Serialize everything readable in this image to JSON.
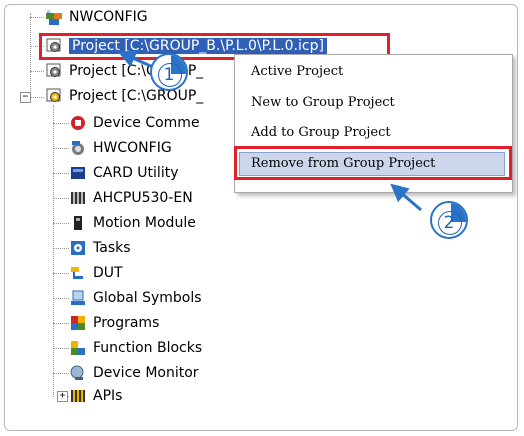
{
  "tree": {
    "nwconfig": "NWCONFIG",
    "projects": [
      "Project [C:\\GROUP_B.\\P.L.0\\P.L.0.icp]",
      "Project [C:\\GROUP_",
      "Project [C:\\GROUP_"
    ],
    "partial_visible": [
      "Project [C",
      "UP_",
      "Project [C",
      "UP_"
    ],
    "children": [
      {
        "label": "Device Comme",
        "icon": "device-comment-icon"
      },
      {
        "label": "HWCONFIG",
        "icon": "hwconfig-icon"
      },
      {
        "label": "CARD Utility",
        "icon": "card-utility-icon"
      },
      {
        "label": "AHCPU530-EN",
        "icon": "cpu-icon"
      },
      {
        "label": "Motion Module",
        "icon": "motion-module-icon"
      },
      {
        "label": "Tasks",
        "icon": "tasks-icon"
      },
      {
        "label": "DUT",
        "icon": "dut-icon"
      },
      {
        "label": "Global Symbols",
        "icon": "global-symbols-icon"
      },
      {
        "label": "Programs",
        "icon": "programs-icon"
      },
      {
        "label": "Function Blocks",
        "icon": "function-blocks-icon"
      },
      {
        "label": "Device Monitor",
        "icon": "device-monitor-icon"
      },
      {
        "label": "APIs",
        "icon": "apis-icon"
      }
    ]
  },
  "context_menu": {
    "items": [
      "Active Project",
      "New to Group Project",
      "Add to Group Project",
      "Remove from Group Project"
    ],
    "highlighted_index": 3
  },
  "annotations": {
    "step1": "1",
    "step2": "2"
  },
  "colors": {
    "selection": "#2f5fb6",
    "highlight_box": "#e0202a",
    "callout_blue": "#2a73c6"
  }
}
